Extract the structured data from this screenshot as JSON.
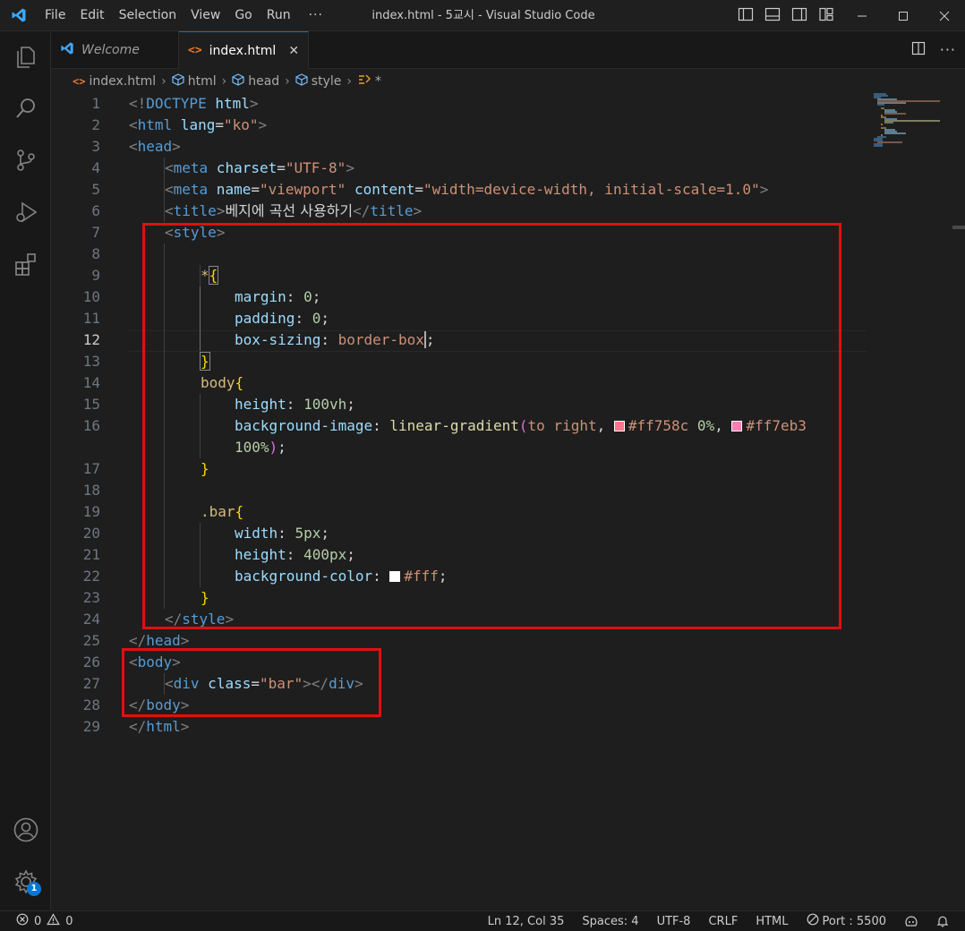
{
  "menu": [
    "File",
    "Edit",
    "Selection",
    "View",
    "Go",
    "Run"
  ],
  "menu_more": "···",
  "window_title": "index.html - 5교시 - Visual Studio Code",
  "tabs": [
    {
      "label": "Welcome",
      "icon": "vscode-logo-icon"
    },
    {
      "label": "index.html",
      "icon": "html-file-icon"
    }
  ],
  "tab_close": "✕",
  "breadcrumb": [
    "index.html",
    "html",
    "head",
    "style",
    "*"
  ],
  "colors": {
    "accent": "#0078d4",
    "highlight": "#e01010",
    "swatch1": "#ff758c",
    "swatch2": "#ff7eb3",
    "swatch3": "#ffffff"
  },
  "editor": {
    "active_line": 12,
    "lines": {
      "l1": {
        "num": "1",
        "a": "<!",
        "b": "DOCTYPE",
        "c": " html",
        "d": ">"
      },
      "l2": {
        "num": "2",
        "a": "<",
        "b": "html",
        "c": " lang",
        "d": "=",
        "e": "\"ko\"",
        "f": ">"
      },
      "l3": {
        "num": "3",
        "a": "<",
        "b": "head",
        "c": ">"
      },
      "l4": {
        "num": "4",
        "a": "<",
        "b": "meta",
        "c": " charset",
        "d": "=",
        "e": "\"UTF-8\"",
        "f": ">"
      },
      "l5": {
        "num": "5",
        "a": "<",
        "b": "meta",
        "c": " name",
        "d": "=",
        "e": "\"viewport\"",
        "f": " content",
        "g": "=",
        "h": "\"width=device-width, initial-scale=1.0\"",
        "i": ">"
      },
      "l6": {
        "num": "6",
        "a": "<",
        "b": "title",
        "c": ">",
        "d": "베지에 곡선 사용하기",
        "e": "</",
        "f": "title",
        "g": ">"
      },
      "l7": {
        "num": "7",
        "a": "<",
        "b": "style",
        "c": ">"
      },
      "l8": {
        "num": "8"
      },
      "l9": {
        "num": "9",
        "a": "*",
        "b": "{"
      },
      "l10": {
        "num": "10",
        "a": "margin",
        "b": ": ",
        "c": "0",
        "d": ";"
      },
      "l11": {
        "num": "11",
        "a": "padding",
        "b": ": ",
        "c": "0",
        "d": ";"
      },
      "l12": {
        "num": "12",
        "a": "box-sizing",
        "b": ": ",
        "c": "border-box",
        "d": ";"
      },
      "l13": {
        "num": "13",
        "a": "}"
      },
      "l14": {
        "num": "14",
        "a": "body",
        "b": "{"
      },
      "l15": {
        "num": "15",
        "a": "height",
        "b": ": ",
        "c": "100vh",
        "d": ";"
      },
      "l16": {
        "num": "16",
        "a": "background-image",
        "b": ": ",
        "c": "linear-gradient",
        "d": "(",
        "e": "to right",
        "f": ", ",
        "g": "#ff758c",
        "h": " 0%",
        "i": ", ",
        "j": "#ff7eb3"
      },
      "l16b": {
        "a": "100%",
        "b": ")",
        "c": ";"
      },
      "l17": {
        "num": "17",
        "a": "}"
      },
      "l18": {
        "num": "18"
      },
      "l19": {
        "num": "19",
        "a": ".bar",
        "b": "{"
      },
      "l20": {
        "num": "20",
        "a": "width",
        "b": ": ",
        "c": "5px",
        "d": ";"
      },
      "l21": {
        "num": "21",
        "a": "height",
        "b": ": ",
        "c": "400px",
        "d": ";"
      },
      "l22": {
        "num": "22",
        "a": "background-color",
        "b": ": ",
        "c": "#fff",
        "d": ";"
      },
      "l23": {
        "num": "23",
        "a": "}"
      },
      "l24": {
        "num": "24",
        "a": "</",
        "b": "style",
        "c": ">"
      },
      "l25": {
        "num": "25",
        "a": "</",
        "b": "head",
        "c": ">"
      },
      "l26": {
        "num": "26",
        "a": "<",
        "b": "body",
        "c": ">"
      },
      "l27": {
        "num": "27",
        "a": "<",
        "b": "div",
        "c": " class",
        "d": "=",
        "e": "\"bar\"",
        "f": "></",
        "g": "div",
        "h": ">"
      },
      "l28": {
        "num": "28",
        "a": "</",
        "b": "body",
        "c": ">"
      },
      "l29": {
        "num": "29",
        "a": "</",
        "b": "html",
        "c": ">"
      }
    }
  },
  "status": {
    "errors": "0",
    "warnings": "0",
    "position": "Ln 12, Col 35",
    "spaces": "Spaces: 4",
    "encoding": "UTF-8",
    "eol": "CRLF",
    "language": "HTML",
    "port": "Port : 5500"
  },
  "account_badge": "1"
}
